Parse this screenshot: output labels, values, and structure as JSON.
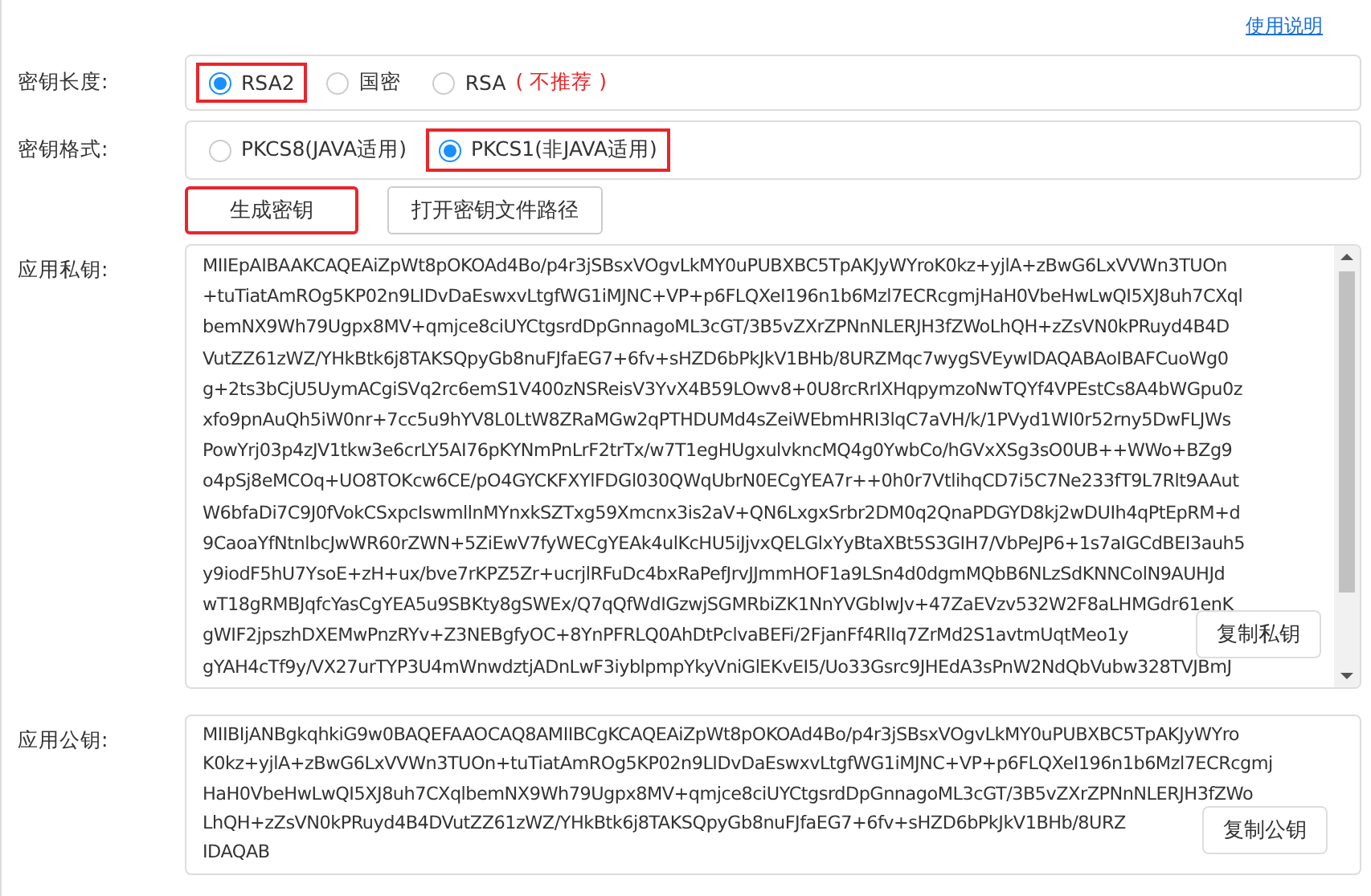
{
  "help_link": "使用说明",
  "key_length": {
    "label": "密钥长度:",
    "options": [
      {
        "label": "RSA2",
        "selected": true,
        "highlighted": true
      },
      {
        "label": "国密",
        "selected": false,
        "highlighted": false
      },
      {
        "label": "RSA",
        "note": "( 不推荐 )",
        "selected": false,
        "highlighted": false
      }
    ]
  },
  "key_format": {
    "label": "密钥格式:",
    "options": [
      {
        "label": "PKCS8(JAVA适用)",
        "selected": false,
        "highlighted": false
      },
      {
        "label": "PKCS1(非JAVA适用)",
        "selected": true,
        "highlighted": true
      }
    ]
  },
  "buttons": [
    {
      "label": "生成密钥",
      "highlighted": true
    },
    {
      "label": "打开密钥文件路径",
      "highlighted": false
    }
  ],
  "private_key": {
    "label": "应用私钥:",
    "copy_button": "复制私钥",
    "lines": [
      "MIIEpAIBAAKCAQEAiZpWt8pOKOAd4Bo/p4r3jSBsxVOgvLkMY0uPUBXBC5TpAKJyWYroK0kz+yjlA+zBwG6LxVVWn3TUOn",
      "+tuTiatAmROg5KP02n9LIDvDaEswxvLtgfWG1iMJNC+VP+p6FLQXeI196n1b6Mzl7ECRcgmjHaH0VbeHwLwQI5XJ8uh7CXql",
      "bemNX9Wh79Ugpx8MV+qmjce8ciUYCtgsrdDpGnnagoML3cGT/3B5vZXrZPNnNLERJH3fZWoLhQH+zZsVN0kPRuyd4B4D",
      "VutZZ61zWZ/YHkBtk6j8TAKSQpyGb8nuFJfaEG7+6fv+sHZD6bPkJkV1BHb/8URZMqc7wygSVEywIDAQABAoIBAFCuoWg0",
      "g+2ts3bCjU5UymACgiSVq2rc6emS1V400zNSReisV3YvX4B59LOwv8+0U8rcRrIXHqpymzoNwTQYf4VPEstCs8A4bWGpu0z",
      "xfo9pnAuQh5iW0nr+7cc5u9hYV8L0LtW8ZRaMGw2qPTHDUMd4sZeiWEbmHRI3lqC7aVH/k/1PVyd1WI0r52rny5DwFLJWs",
      "PowYrj03p4zJV1tkw3e6crLY5AI76pKYNmPnLrF2trTx/w7T1egHUgxulvkncMQ4g0YwbCo/hGVxXSg3sO0UB++WWo+BZg9",
      "o4pSj8eMCOq+UO8TOKcw6CE/pO4GYCKFXYlFDGl030QWqUbrN0ECgYEA7r++0h0r7VtlihqCD7i5C7Ne233fT9L7Rlt9AAut",
      "W6bfaDi7C9J0fVokCSxpcIswmllnMYnxkSZTxg59Xmcnx3is2aV+QN6LxgxSrbr2DM0q2QnaPDGYD8kj2wDUIh4qPtEpRM+d",
      "9CaoaYfNtnlbcJwWR60rZWN+5ZiEwV7fyWECgYEAk4ulKcHU5iJjvxQELGlxYyBtaXBt5S3GIH7/VbPeJP6+1s7aIGCdBEI3auh5",
      "y9iodF5hU7YsoE+zH+ux/bve7rKPZ5Zr+ucrjlRFuDc4bxRaPefJrvJJmmHOF1a9LSn4d0dgmMQbB6NLzSdKNNColN9AUHJd",
      "wT18gRMBJqfcYasCgYEA5u9SBKty8gSWEx/Q7qQfWdIGzwjSGMRbiZK1NnYVGbIwJv+47ZaEVzv532W2F8aLHMGdr61enK",
      "gWIF2jpszhDXEMwPnzRYv+Z3NEBgfyOC+8YnPFRLQ0AhDtPclvaBEFi/2FjanFf4RlIq7ZrMd2S1avtmUqtMeo1y",
      "gYAH4cTf9y/VX27urTYP3U4mWnwdztjADnLwF3iyblpmpYkyVniGlEKvEI5/Uo33Gsrc9JHEdA3sPnW2NdQbVubw328TVJBmJ"
    ]
  },
  "public_key": {
    "label": "应用公钥:",
    "copy_button": "复制公钥",
    "lines": [
      "MIIBIjANBgkqhkiG9w0BAQEFAAOCAQ8AMIIBCgKCAQEAiZpWt8pOKOAd4Bo/p4r3jSBsxVOgvLkMY0uPUBXBC5TpAKJyWYro",
      "K0kz+yjlA+zBwG6LxVVWn3TUOn+tuTiatAmROg5KP02n9LIDvDaEswxvLtgfWG1iMJNC+VP+p6FLQXeI196n1b6Mzl7ECRcgmj",
      "HaH0VbeHwLwQI5XJ8uh7CXqlbemNX9Wh79Ugpx8MV+qmjce8ciUYCtgsrdDpGnnagoML3cGT/3B5vZXrZPNnNLERJH3fZWo",
      "LhQH+zZsVN0kPRuyd4B4DVutZZ61zWZ/YHkBtk6j8TAKSQpyGb8nuFJfaEG7+6fv+sHZD6bPkJkV1BHb/8URZ",
      "IDAQAB"
    ]
  }
}
